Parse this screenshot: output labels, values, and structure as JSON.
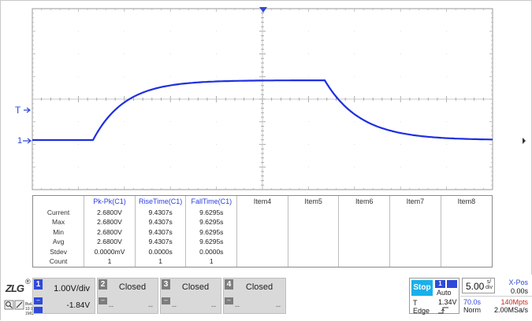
{
  "colors": {
    "trace": "#1f2fe0",
    "grid": "#c8c8c8",
    "accent_blue": "#2f49d9",
    "stop": "#19b0ea",
    "sample_red": "#c8281e"
  },
  "markers": {
    "trigger_level_label": "T",
    "channel1_label": "1"
  },
  "measurements": {
    "columns": [
      "Pk-Pk(C1)",
      "RiseTime(C1)",
      "FallTime(C1)",
      "Item4",
      "Item5",
      "Item6",
      "Item7",
      "Item8"
    ],
    "rows": [
      {
        "label": "Current",
        "values": [
          "2.6800V",
          "9.4307s",
          "9.6295s"
        ]
      },
      {
        "label": "Max",
        "values": [
          "2.6800V",
          "9.4307s",
          "9.6295s"
        ]
      },
      {
        "label": "Min",
        "values": [
          "2.6800V",
          "9.4307s",
          "9.6295s"
        ]
      },
      {
        "label": "Avg",
        "values": [
          "2.6800V",
          "9.4307s",
          "9.6295s"
        ]
      },
      {
        "label": "Stdev",
        "values": [
          "0.0000mV",
          "0.0000s",
          "0.0000s"
        ]
      },
      {
        "label": "Count",
        "values": [
          "1",
          "1",
          "1"
        ]
      }
    ]
  },
  "channels": {
    "ch1": {
      "num": "1",
      "scale": "1.00V/div",
      "offset": "-1.84V"
    },
    "ch2": {
      "num": "2",
      "state": "Closed",
      "dash": "--"
    },
    "ch3": {
      "num": "3",
      "state": "Closed",
      "dash": "--"
    },
    "ch4": {
      "num": "4",
      "state": "Closed",
      "dash": "--"
    }
  },
  "logo": {
    "text": "ZLG",
    "registered": "®",
    "sub": "BwL 10:1 1MΩ"
  },
  "trigger": {
    "status": "Stop",
    "source": "1",
    "mode": "Auto",
    "type_label": "T",
    "level": "1.34V",
    "type": "Edge"
  },
  "timebase": {
    "value": "5.00",
    "unit_top": "s/",
    "unit_bottom": "div",
    "xpos_label": "X-Pos",
    "xpos_value": "0.00s",
    "span": "70.0s",
    "memory": "140Mpts",
    "acq_mode": "Norm",
    "sample_rate": "2.00MSa/s"
  }
}
